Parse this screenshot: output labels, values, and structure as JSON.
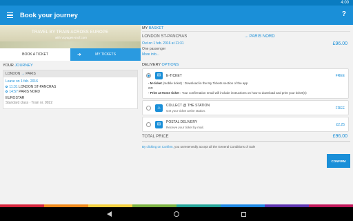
{
  "status": {
    "time": "4:00"
  },
  "appbar": {
    "title": "Book your journey",
    "help": "?"
  },
  "banner": {
    "line1": "TRAVEL BY TRAIN ACROSS EUROPE",
    "line2": "with Voyages-sncf.com"
  },
  "tabs": {
    "book": "BOOK A TICKET",
    "my": "MY TICKETS"
  },
  "journey": {
    "title_plain": "YOUR",
    "title_accent": "JOURNEY",
    "route_from": "LONDON",
    "route_arrow": "→",
    "route_to": "PARIS",
    "leave": "Leave on 1 feb. 2016",
    "dep_time": "11:31",
    "dep_station": "LONDON ST-PANCRAS",
    "arr_time": "14:57",
    "arr_station": "PARIS NORD",
    "operator": "EUROSTAR",
    "class_info": "Standard class  ·  Train nr. 9022"
  },
  "basket": {
    "title_plain": "MY",
    "title_accent": "BASKET",
    "from": "LONDON ST-PANCRAS",
    "to": "→ PARIS NORD",
    "out": "Out on 1 feb. 2016 at 11:31",
    "passengers": "One passenger",
    "more": "More info...",
    "price": "£96.00"
  },
  "delivery": {
    "title_plain": "DELIVERY",
    "title_accent": "OPTIONS",
    "eticket": {
      "title": "E-TICKET",
      "price": "FREE",
      "m_label": "- M-ticket",
      "m_text": "(mobile ticket) : Download in the My Tickets section of the app",
      "or": "OR",
      "p_label": "- Print at Home ticket",
      "p_text": ": Your confirmation email will include instructions on how to download and print your ticket(s)"
    },
    "collect": {
      "title": "COLLECT @ THE STATION",
      "sub": "Get your ticket at the station.",
      "price": "FREE"
    },
    "postal": {
      "title": "POSTAL DELIVERY",
      "sub": "Receive your ticket by mail.",
      "price": "£2.25"
    }
  },
  "total": {
    "label": "TOTAL PRICE",
    "value": "£96.00"
  },
  "conditions": {
    "accent": "By clicking on Confirm,",
    "text": " you unreservedly accept all the General Conditions of Sale"
  },
  "confirm": "CONFIRM",
  "colors": {
    "primary": "#1a8fd8",
    "strip": [
      "#d7263d",
      "#f08a1c",
      "#f4d03f",
      "#7cb342",
      "#26a69a",
      "#1e88e5",
      "#5e35b1",
      "#c2185b"
    ]
  }
}
